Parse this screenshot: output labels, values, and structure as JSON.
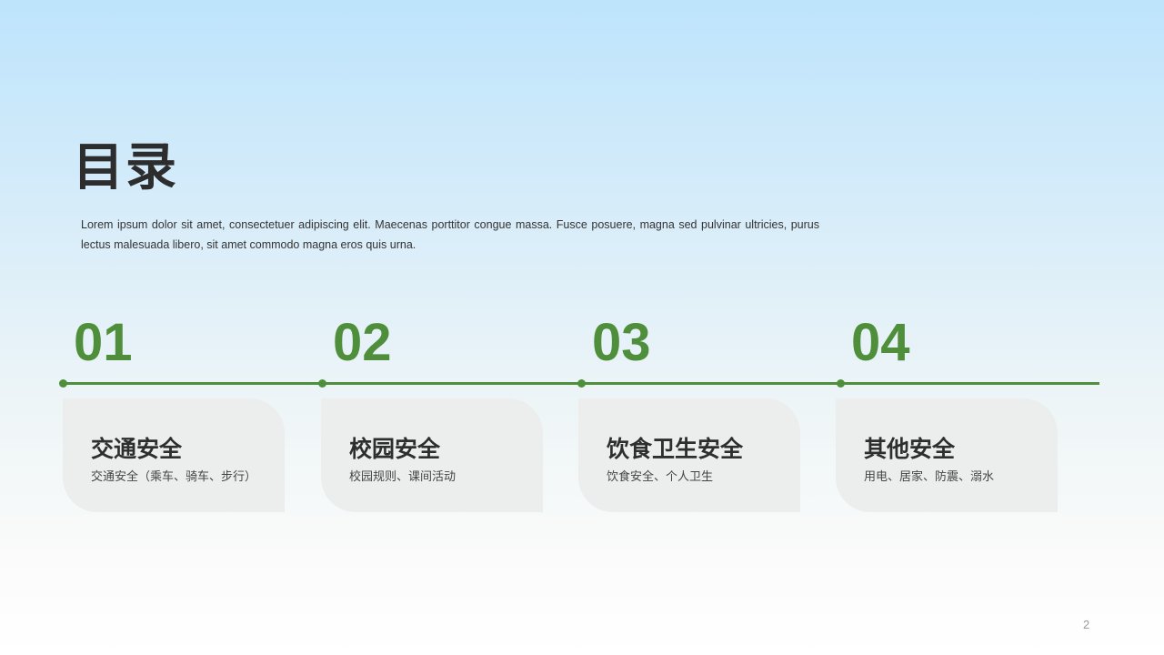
{
  "slide": {
    "title": "目录",
    "intro": "Lorem ipsum dolor sit amet, consectetuer adipiscing elit. Maecenas porttitor congue massa. Fusce posuere, magna sed pulvinar ultricies, purus lectus malesuada libero, sit amet commodo magna eros quis urna.",
    "page_number": "2",
    "accent_color": "#4f8f3c",
    "card_color": "#eceeee",
    "items": [
      {
        "number": "01",
        "title": "交通安全",
        "subtitle": "交通安全（乘车、骑车、步行）"
      },
      {
        "number": "02",
        "title": "校园安全",
        "subtitle": "校园规则、课间活动"
      },
      {
        "number": "03",
        "title": "饮食卫生安全",
        "subtitle": "饮食安全、个人卫生"
      },
      {
        "number": "04",
        "title": "其他安全",
        "subtitle": "用电、居家、防震、溺水"
      }
    ]
  }
}
